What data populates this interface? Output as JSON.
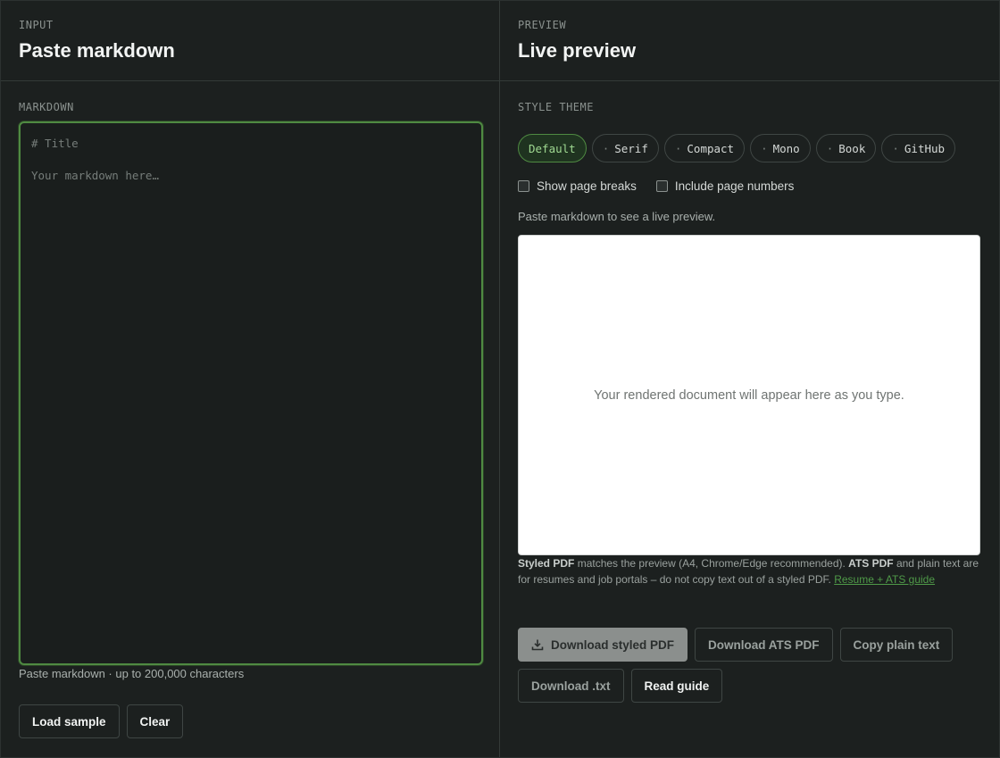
{
  "input": {
    "eyebrow": "INPUT",
    "title": "Paste markdown",
    "section_label": "MARKDOWN",
    "placeholder": "# Title\n\nYour markdown here…",
    "hint": "Paste markdown · up to 200,000 characters",
    "load_sample_label": "Load sample",
    "clear_label": "Clear"
  },
  "preview": {
    "eyebrow": "PREVIEW",
    "title": "Live preview",
    "section_label": "STYLE THEME",
    "themes": [
      {
        "label": "Default",
        "active": true
      },
      {
        "label": "Serif",
        "active": false
      },
      {
        "label": "Compact",
        "active": false
      },
      {
        "label": "Mono",
        "active": false
      },
      {
        "label": "Book",
        "active": false
      },
      {
        "label": "GitHub",
        "active": false
      }
    ],
    "show_page_breaks_label": "Show page breaks",
    "include_page_numbers_label": "Include page numbers",
    "note": "Paste markdown to see a live preview.",
    "empty_text": "Your rendered document will appear here as you type.",
    "info": {
      "styled_pdf": "Styled PDF",
      "text1": " matches the preview (A4, Chrome/Edge recommended). ",
      "ats_pdf": "ATS PDF",
      "text2": " and plain text are for resumes and job portals – do not copy text out of a styled PDF. ",
      "link": "Resume + ATS guide"
    },
    "download_styled_label": "Download styled PDF",
    "download_ats_label": "Download ATS PDF",
    "copy_plain_label": "Copy plain text",
    "download_txt_label": "Download .txt",
    "read_guide_label": "Read guide"
  },
  "colors": {
    "accent": "#4f8a42",
    "background": "#1c201f"
  }
}
